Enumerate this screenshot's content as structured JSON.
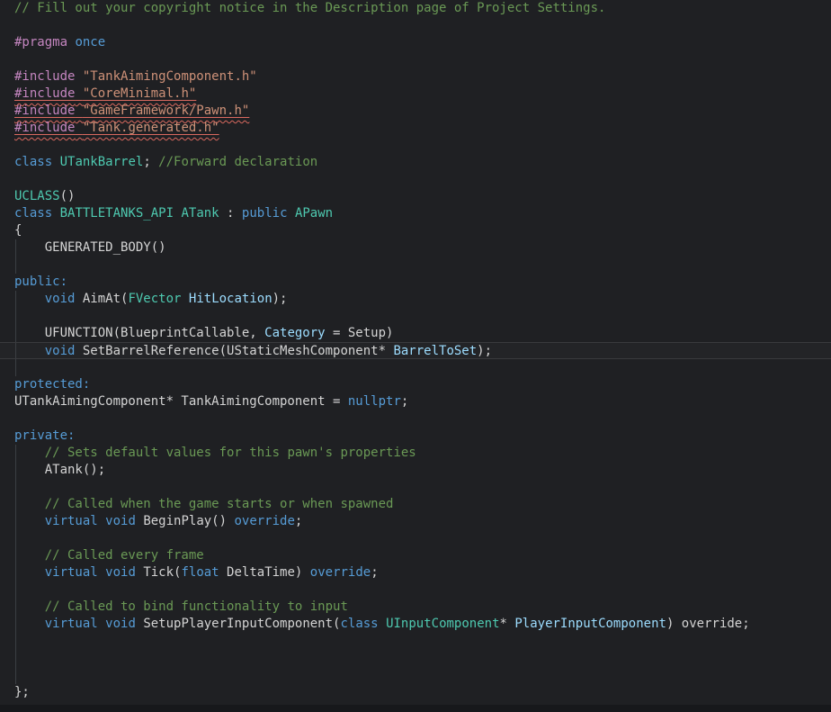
{
  "app": {
    "kind": "code-editor",
    "language_shown": "cpp-header"
  },
  "colors": {
    "background": "#1f2023",
    "bottom_edge": "#17181b",
    "comment": "#6a9955",
    "keyword": "#569cd6",
    "preprocessor": "#c586c0",
    "string": "#ce9178",
    "type": "#4ec9b0",
    "parameter": "#9cdcfe",
    "plain_text": "#d4d4d4",
    "error_squiggle": "#d9695f",
    "indent_guide": "#3b3e43"
  },
  "code": {
    "lines": [
      {
        "tokens": [
          [
            "cm",
            "// Fill out your copyright notice in the Description page of Project Settings."
          ]
        ]
      },
      {
        "tokens": []
      },
      {
        "tokens": [
          [
            "pp",
            "#pragma"
          ],
          [
            "tx",
            " "
          ],
          [
            "kw",
            "once"
          ]
        ]
      },
      {
        "tokens": []
      },
      {
        "tokens": [
          [
            "pp",
            "#include"
          ],
          [
            "tx",
            " "
          ],
          [
            "str",
            "\"TankAimingComponent.h\""
          ]
        ]
      },
      {
        "underline": true,
        "tokens": [
          [
            "pp",
            "#include"
          ],
          [
            "tx",
            " "
          ],
          [
            "str",
            "\"CoreMinimal.h\""
          ]
        ]
      },
      {
        "underline": true,
        "tokens": [
          [
            "pp",
            "#include"
          ],
          [
            "tx",
            " "
          ],
          [
            "str",
            "\"GameFramework/Pawn.h\""
          ]
        ]
      },
      {
        "underline": true,
        "tokens": [
          [
            "pp",
            "#include"
          ],
          [
            "tx",
            " "
          ],
          [
            "str",
            "\"Tank.generated.h\""
          ]
        ]
      },
      {
        "tokens": []
      },
      {
        "tokens": [
          [
            "kw",
            "class"
          ],
          [
            "tx",
            " "
          ],
          [
            "ty",
            "UTankBarrel"
          ],
          [
            "tx",
            "; "
          ],
          [
            "cm",
            "//Forward declaration"
          ]
        ]
      },
      {
        "tokens": []
      },
      {
        "tokens": [
          [
            "ty",
            "UCLASS"
          ],
          [
            "tx",
            "()"
          ]
        ]
      },
      {
        "tokens": [
          [
            "kw",
            "class"
          ],
          [
            "tx",
            " "
          ],
          [
            "ty",
            "BATTLETANKS_API"
          ],
          [
            "tx",
            " "
          ],
          [
            "ty",
            "ATank"
          ],
          [
            "tx",
            " : "
          ],
          [
            "kw",
            "public"
          ],
          [
            "tx",
            " "
          ],
          [
            "ty",
            "APawn"
          ]
        ]
      },
      {
        "tokens": [
          [
            "tx",
            "{"
          ]
        ]
      },
      {
        "guide": true,
        "tokens": [
          [
            "tx",
            "    GENERATED_BODY()"
          ]
        ]
      },
      {
        "guide": true,
        "tokens": []
      },
      {
        "tokens": [
          [
            "kw",
            "public:"
          ]
        ]
      },
      {
        "guide": true,
        "tokens": [
          [
            "tx",
            "    "
          ],
          [
            "kw",
            "void"
          ],
          [
            "tx",
            " AimAt("
          ],
          [
            "ty",
            "FVector"
          ],
          [
            "tx",
            " "
          ],
          [
            "pr",
            "HitLocation"
          ],
          [
            "tx",
            ");"
          ]
        ]
      },
      {
        "guide": true,
        "tokens": []
      },
      {
        "guide": true,
        "tokens": [
          [
            "tx",
            "    UFUNCTION(BlueprintCallable, "
          ],
          [
            "pr",
            "Category"
          ],
          [
            "tx",
            " = Setup)"
          ]
        ]
      },
      {
        "guide": true,
        "highlight": true,
        "tokens": [
          [
            "tx",
            "    "
          ],
          [
            "kw",
            "void"
          ],
          [
            "tx",
            " SetBarrelReference(UStaticMeshComponent* "
          ],
          [
            "pr",
            "BarrelToSet"
          ],
          [
            "tx",
            ");"
          ]
        ]
      },
      {
        "guide": true,
        "tokens": []
      },
      {
        "tokens": [
          [
            "kw",
            "protected:"
          ]
        ]
      },
      {
        "tokens": [
          [
            "tx",
            "UTankAimingComponent* TankAimingComponent = "
          ],
          [
            "kw",
            "nullptr"
          ],
          [
            "tx",
            ";"
          ]
        ]
      },
      {
        "tokens": []
      },
      {
        "tokens": [
          [
            "kw",
            "private:"
          ]
        ]
      },
      {
        "guide": true,
        "tokens": [
          [
            "tx",
            "    "
          ],
          [
            "cm",
            "// Sets default values for this pawn's properties"
          ]
        ]
      },
      {
        "guide": true,
        "tokens": [
          [
            "tx",
            "    ATank();"
          ]
        ]
      },
      {
        "guide": true,
        "tokens": []
      },
      {
        "guide": true,
        "tokens": [
          [
            "tx",
            "    "
          ],
          [
            "cm",
            "// Called when the game starts or when spawned"
          ]
        ]
      },
      {
        "guide": true,
        "tokens": [
          [
            "tx",
            "    "
          ],
          [
            "kw",
            "virtual"
          ],
          [
            "tx",
            " "
          ],
          [
            "kw",
            "void"
          ],
          [
            "tx",
            " BeginPlay() "
          ],
          [
            "kw",
            "override"
          ],
          [
            "tx",
            ";"
          ]
        ]
      },
      {
        "guide": true,
        "tokens": []
      },
      {
        "guide": true,
        "tokens": [
          [
            "tx",
            "    "
          ],
          [
            "cm",
            "// Called every frame"
          ]
        ]
      },
      {
        "guide": true,
        "tokens": [
          [
            "tx",
            "    "
          ],
          [
            "kw",
            "virtual"
          ],
          [
            "tx",
            " "
          ],
          [
            "kw",
            "void"
          ],
          [
            "tx",
            " Tick("
          ],
          [
            "kw",
            "float"
          ],
          [
            "tx",
            " DeltaTime) "
          ],
          [
            "kw",
            "override"
          ],
          [
            "tx",
            ";"
          ]
        ]
      },
      {
        "guide": true,
        "tokens": []
      },
      {
        "guide": true,
        "tokens": [
          [
            "tx",
            "    "
          ],
          [
            "cm",
            "// Called to bind functionality to input"
          ]
        ]
      },
      {
        "guide": true,
        "tokens": [
          [
            "tx",
            "    "
          ],
          [
            "kw",
            "virtual"
          ],
          [
            "tx",
            " "
          ],
          [
            "kw",
            "void"
          ],
          [
            "tx",
            " SetupPlayerInputComponent("
          ],
          [
            "kw",
            "class"
          ],
          [
            "tx",
            " "
          ],
          [
            "ty",
            "UInputComponent"
          ],
          [
            "tx",
            "* "
          ],
          [
            "pr",
            "PlayerInputComponent"
          ],
          [
            "tx",
            ") override;"
          ]
        ]
      },
      {
        "guide": true,
        "tokens": []
      },
      {
        "guide": true,
        "tokens": []
      },
      {
        "guide": true,
        "tokens": []
      },
      {
        "tokens": [
          [
            "tx",
            "};"
          ]
        ]
      }
    ]
  }
}
